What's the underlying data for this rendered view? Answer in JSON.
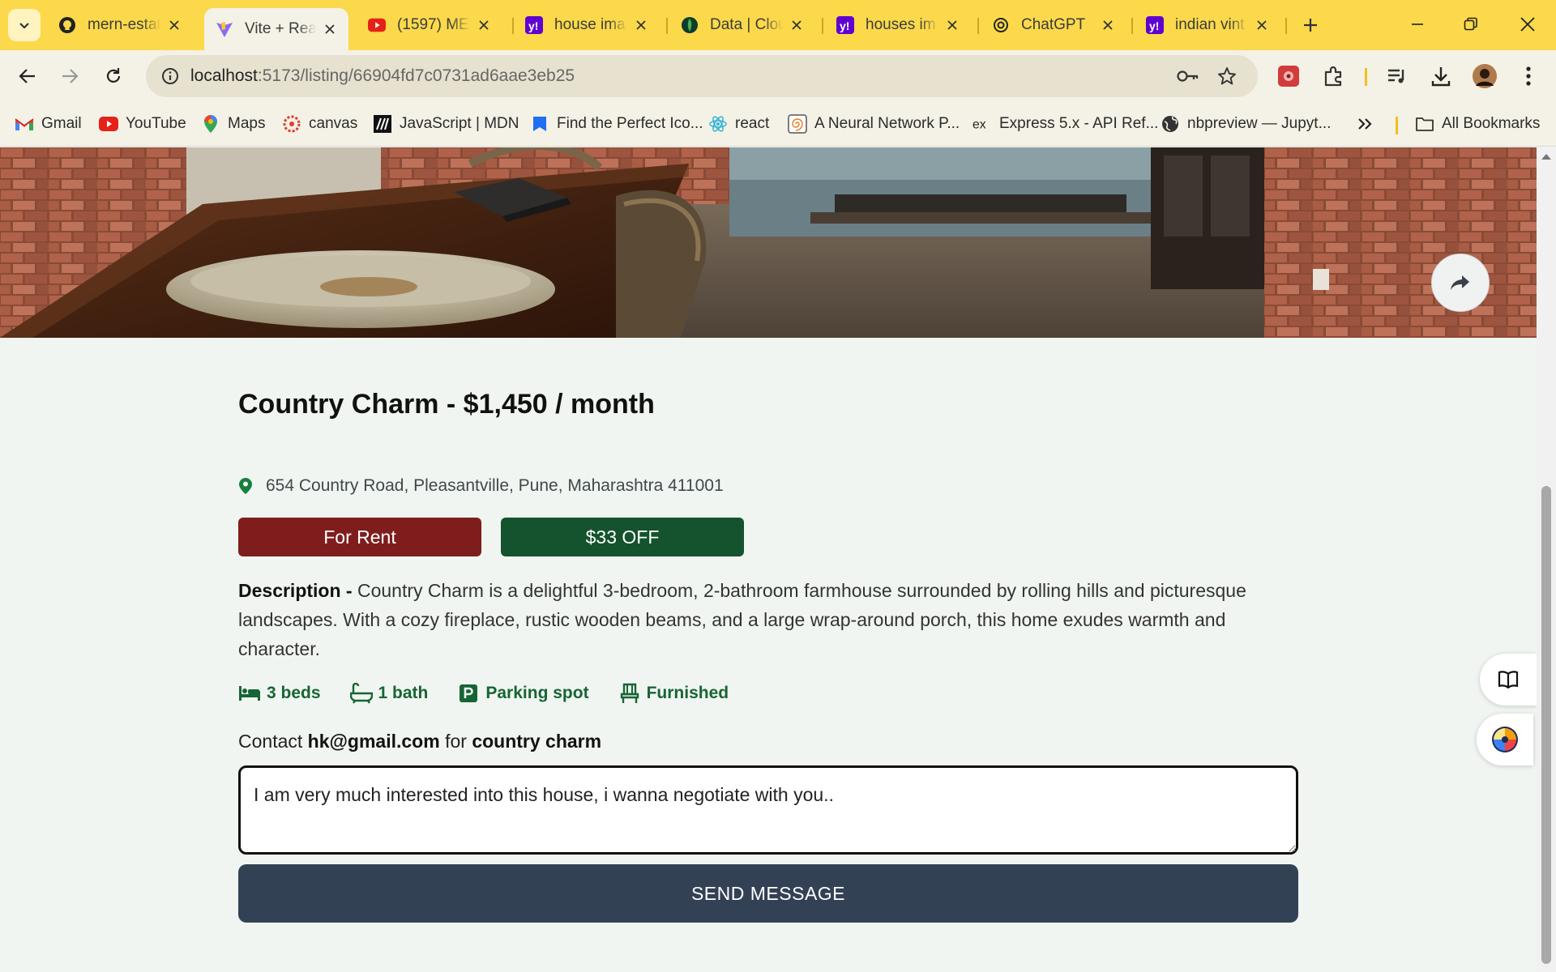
{
  "browser": {
    "tabs": [
      {
        "title": "mern-estat",
        "icon": "github-icon"
      },
      {
        "title": "Vite + Rea",
        "icon": "vite-icon",
        "active": true
      },
      {
        "title": "(1597) MER",
        "icon": "youtube-icon"
      },
      {
        "title": "house ima",
        "icon": "yahoo-icon"
      },
      {
        "title": "Data | Clou",
        "icon": "mongodb-icon"
      },
      {
        "title": "houses im",
        "icon": "yahoo-icon"
      },
      {
        "title": "ChatGPT",
        "icon": "chatgpt-icon"
      },
      {
        "title": "indian vint",
        "icon": "yahoo-icon"
      }
    ],
    "address": {
      "host": "localhost",
      "path": ":5173/listing/66904fd7c0731ad6aae3eb25"
    },
    "bookmarks": [
      {
        "label": "Gmail",
        "icon": "gmail-icon"
      },
      {
        "label": "YouTube",
        "icon": "youtube-icon"
      },
      {
        "label": "Maps",
        "icon": "maps-icon"
      },
      {
        "label": "canvas",
        "icon": "canvas-icon"
      },
      {
        "label": "JavaScript | MDN",
        "icon": "mdn-icon"
      },
      {
        "label": "Find the Perfect Ico...",
        "icon": "flag-icon"
      },
      {
        "label": "react",
        "icon": "react-icon"
      },
      {
        "label": "A Neural Network P...",
        "icon": "spiral-icon"
      },
      {
        "label": "Express 5.x - API Ref...",
        "icon": "express-icon"
      },
      {
        "label": "nbpreview — Jupyt...",
        "icon": "globe-icon"
      }
    ],
    "all_bookmarks": "All Bookmarks",
    "colors": {
      "chrome": "#fbd94b",
      "toolbar": "#f4f1e6"
    }
  },
  "listing": {
    "title": "Country Charm - $1,450 / month",
    "address": "654 Country Road, Pleasantville, Pune, Maharashtra 411001",
    "type_badge": "For Rent",
    "discount_badge": "$33 OFF",
    "description_label": "Description - ",
    "description": "Country Charm is a delightful 3-bedroom, 2-bathroom farmhouse surrounded by rolling hills and picturesque landscapes. With a cozy fireplace, rustic wooden beams, and a large wrap-around porch, this home exudes warmth and character.",
    "features": [
      {
        "label": "3 beds",
        "icon": "bed-icon"
      },
      {
        "label": "1 bath",
        "icon": "bath-icon"
      },
      {
        "label": "Parking spot",
        "icon": "parking-icon"
      },
      {
        "label": "Furnished",
        "icon": "chair-icon"
      }
    ],
    "colors": {
      "rent": "#7f1d1d",
      "offer": "#14532d",
      "feature": "#166534",
      "send": "#334155"
    }
  },
  "contact": {
    "prefix": "Contact ",
    "email": "hk@gmail.com",
    "middle": " for ",
    "name": "country charm",
    "message": "I am very much interested into this house, i wanna negotiate with you..",
    "send_label": "SEND MESSAGE"
  }
}
